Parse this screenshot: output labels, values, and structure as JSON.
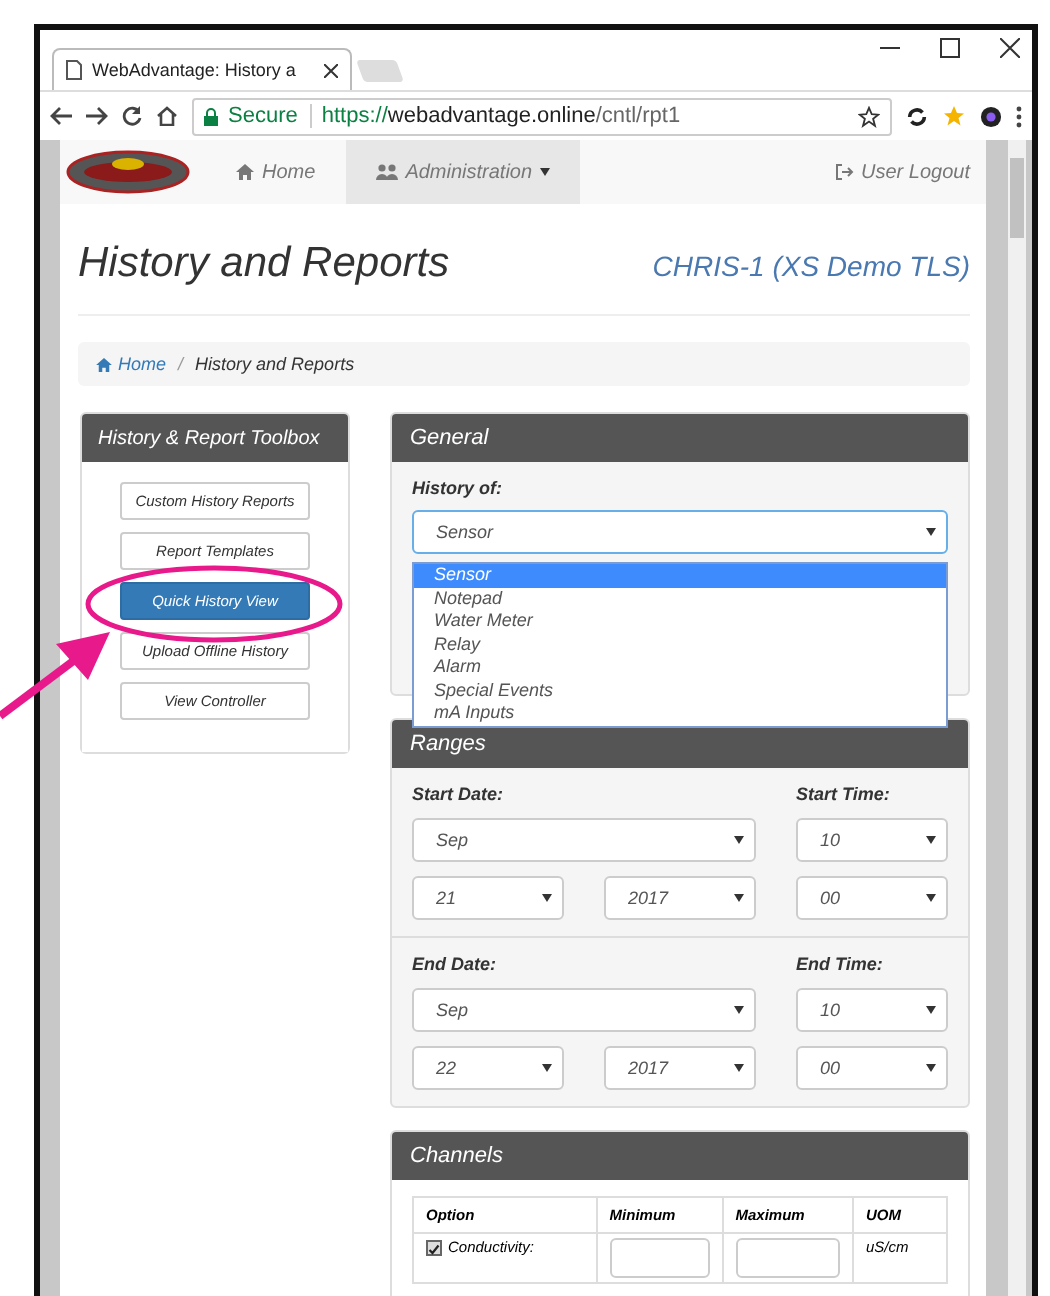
{
  "browser": {
    "tab_title": "WebAdvantage: History a",
    "secure_label": "Secure",
    "url_scheme": "https://",
    "url_host": "webadvantage.online",
    "url_path": "/cntl/rpt1"
  },
  "navbar": {
    "items": [
      {
        "kind": "home",
        "label": "Home",
        "selected": false
      },
      {
        "kind": "dropdown",
        "label": "Administration",
        "selected": true
      }
    ],
    "logout": "User Logout"
  },
  "header": {
    "title": "History and Reports",
    "device": "CHRIS-1 (XS Demo TLS)"
  },
  "breadcrumb": {
    "separator": "/",
    "items": [
      {
        "label": "Home",
        "link": true
      },
      {
        "label": "History and Reports",
        "link": false
      }
    ]
  },
  "toolbox": {
    "title": "History & Report Toolbox",
    "buttons": [
      {
        "label": "Custom History Reports",
        "selected": false
      },
      {
        "label": "Report Templates",
        "selected": false
      },
      {
        "label": "Quick History View",
        "selected": true
      },
      {
        "label": "Upload Offline History",
        "selected": false
      },
      {
        "label": "View Controller",
        "selected": false
      }
    ]
  },
  "general": {
    "title": "General",
    "history_label": "History of:",
    "value": "Sensor",
    "expanded": true,
    "options": [
      {
        "label": "Sensor",
        "selected": true
      },
      {
        "label": "Notepad",
        "selected": false
      },
      {
        "label": "Water Meter",
        "selected": false
      },
      {
        "label": "Relay",
        "selected": false
      },
      {
        "label": "Alarm",
        "selected": false
      },
      {
        "label": "Special Events",
        "selected": false
      },
      {
        "label": "mA Inputs",
        "selected": false
      }
    ]
  },
  "ranges": {
    "title": "Ranges",
    "groups": [
      {
        "date_label": "Start Date:",
        "time_label": "Start Time:",
        "month": "Sep",
        "day": "21",
        "year": "2017",
        "hour": "10",
        "minute": "00"
      },
      {
        "date_label": "End Date:",
        "time_label": "End Time:",
        "month": "Sep",
        "day": "22",
        "year": "2017",
        "hour": "10",
        "minute": "00"
      }
    ]
  },
  "channels": {
    "title": "Channels",
    "columns": [
      "Option",
      "Minimum",
      "Maximum",
      "UOM"
    ],
    "rows": [
      {
        "checked": true,
        "option": "Conductivity:",
        "uom": "uS/cm"
      }
    ]
  }
}
